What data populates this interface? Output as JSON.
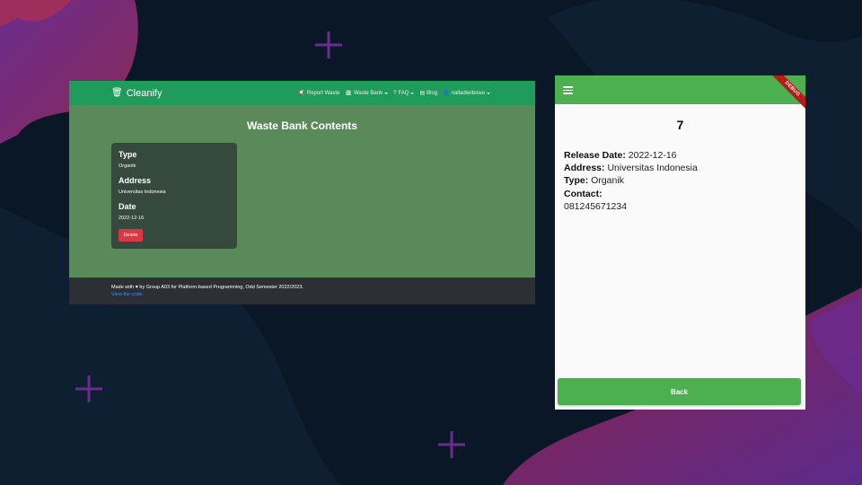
{
  "colors": {
    "web_nav": "#1f9b5b",
    "web_body": "#5b8a5a",
    "card": "#354a3c",
    "delete": "#dc3545",
    "footer": "#2c3034",
    "footer_link": "#3d8bfd",
    "app_bar": "#4caf50",
    "debug_banner": "#b71c1c"
  },
  "web": {
    "brand": {
      "icon": "trash-icon",
      "name": "Cleanify"
    },
    "nav": [
      {
        "icon": "megaphone-icon",
        "label": "Report Waste",
        "dropdown": false
      },
      {
        "icon": "bank-icon",
        "label": "Waste Bank",
        "dropdown": true
      },
      {
        "icon": "question-circle-icon",
        "label": "FAQ",
        "dropdown": true
      },
      {
        "icon": "newspaper-icon",
        "label": "Blog",
        "dropdown": false
      },
      {
        "icon": "user-icon",
        "label": "nalladiwibowo",
        "dropdown": true
      }
    ],
    "title": "Waste Bank Contents",
    "card": {
      "type_label": "Type",
      "type_value": "Organik",
      "address_label": "Address",
      "address_value": "Universitas Indonesia",
      "date_label": "Date",
      "date_value": "2022-12-16",
      "delete_label": "Delete"
    },
    "footer": {
      "text": "Made with ♥ by Group A03 for Platform-based Programming, Odd Semester 2022/2023.",
      "link": "View the code."
    }
  },
  "mobile": {
    "menu_icon": "hamburger-menu-icon",
    "debug_banner": "DEBUG",
    "title": "7",
    "release_label": "Release Date:",
    "release_value": "2022-12-16",
    "address_label": "Address:",
    "address_value": "Universitas Indonesia",
    "type_label": "Type:",
    "type_value": "Organik",
    "contact_label": "Contact:",
    "contact_value": "081245671234",
    "back_label": "Back"
  }
}
